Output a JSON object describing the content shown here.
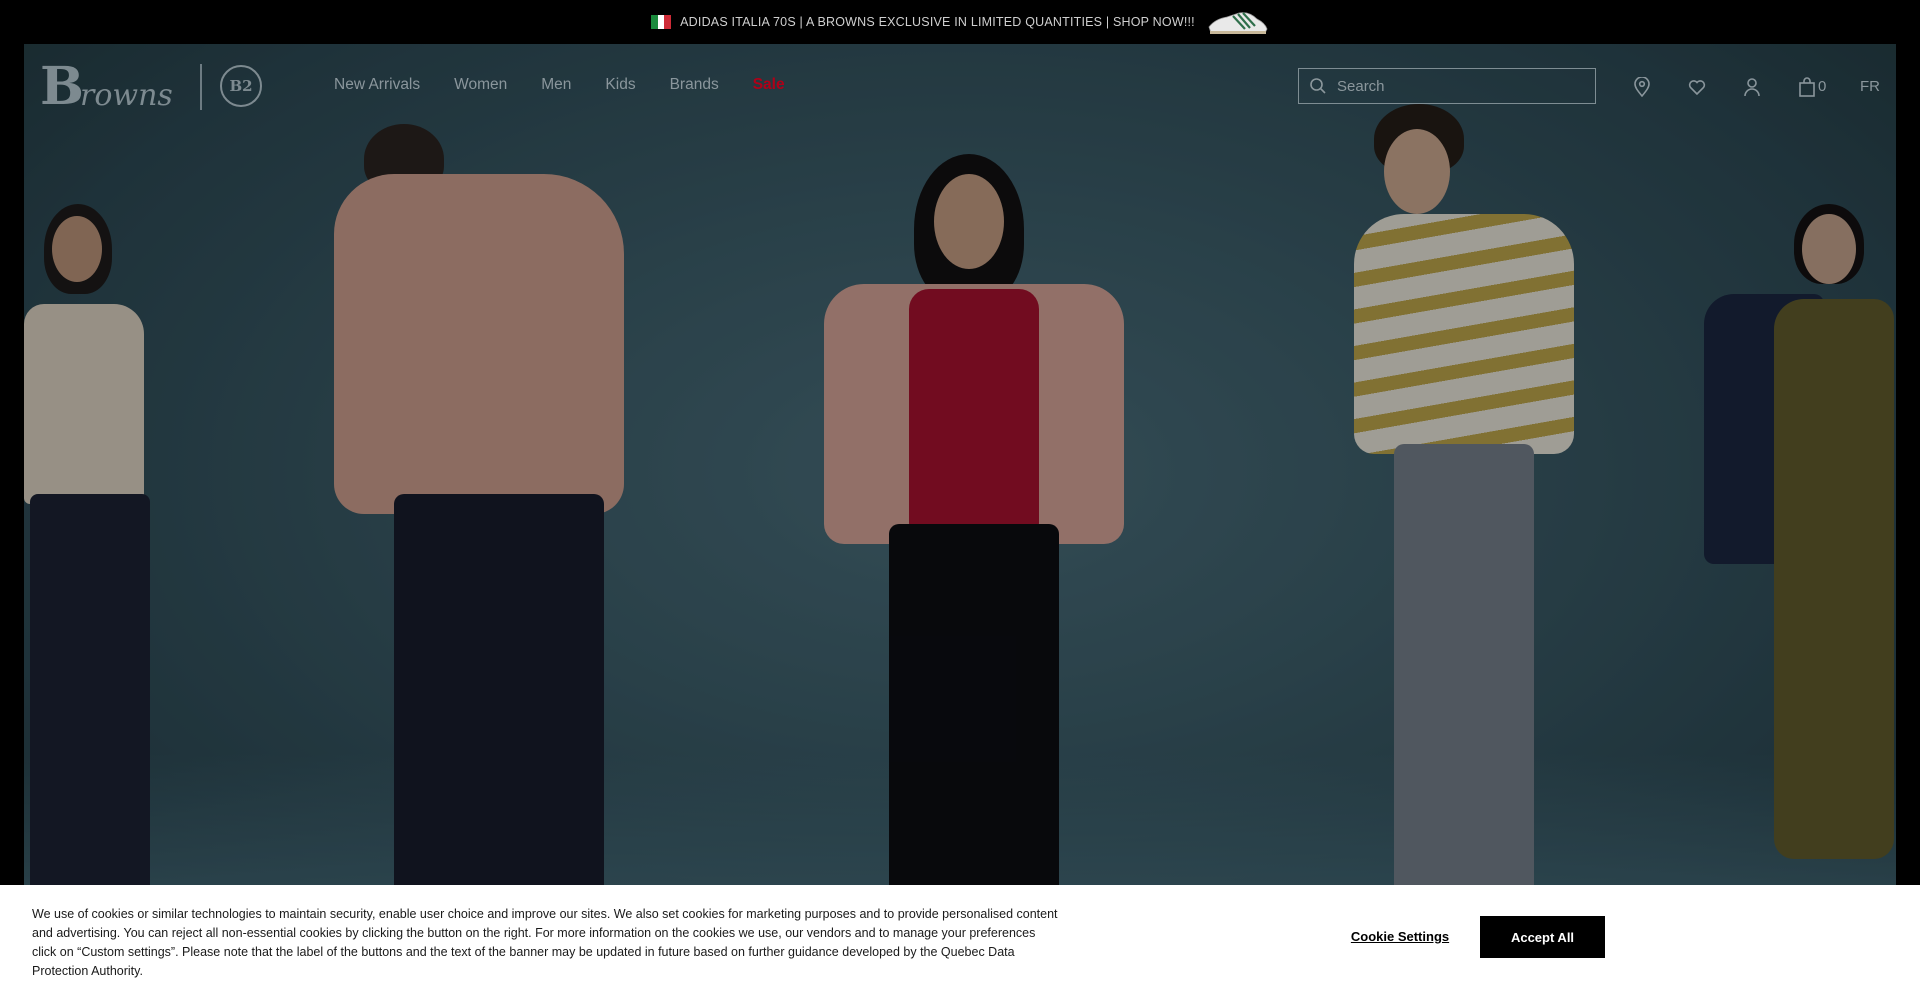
{
  "promo": {
    "text": "ADIDAS ITALIA 70S | A BROWNS EXCLUSIVE IN LIMITED QUANTITIES | SHOP NOW!!!",
    "flag_colors": [
      "#1a8a3c",
      "#ffffff",
      "#ce2b37"
    ]
  },
  "header": {
    "logo_text": "Browns",
    "logo_b": "B",
    "logo_script": "rowns",
    "b2_text": "B2",
    "nav": [
      {
        "label": "New Arrivals"
      },
      {
        "label": "Women"
      },
      {
        "label": "Men"
      },
      {
        "label": "Kids"
      },
      {
        "label": "Brands"
      },
      {
        "label": "Sale"
      }
    ],
    "search_placeholder": "Search",
    "cart_count": "0",
    "language": "FR",
    "icons": [
      "search-icon",
      "location-pin-icon",
      "heart-icon",
      "user-icon",
      "shopping-bag-icon"
    ]
  },
  "cookie": {
    "message": "We use of cookies or similar technologies to maintain security, enable user choice and improve our sites. We also set cookies for marketing purposes and to provide personalised content and advertising. You can reject all non-essential cookies by clicking the button on the right. For more information on the cookies we use, our vendors and to manage your preferences click on “Custom settings”. Please note that the label of the buttons and the text of the banner may be updated in future based on further guidance developed by the Quebec Data Protection Authority.",
    "settings_label": "Cookie Settings",
    "accept_label": "Accept All"
  },
  "colors": {
    "sale": "#b00018",
    "hero_bg": "#3c5d69",
    "accept_bg": "#000000"
  }
}
